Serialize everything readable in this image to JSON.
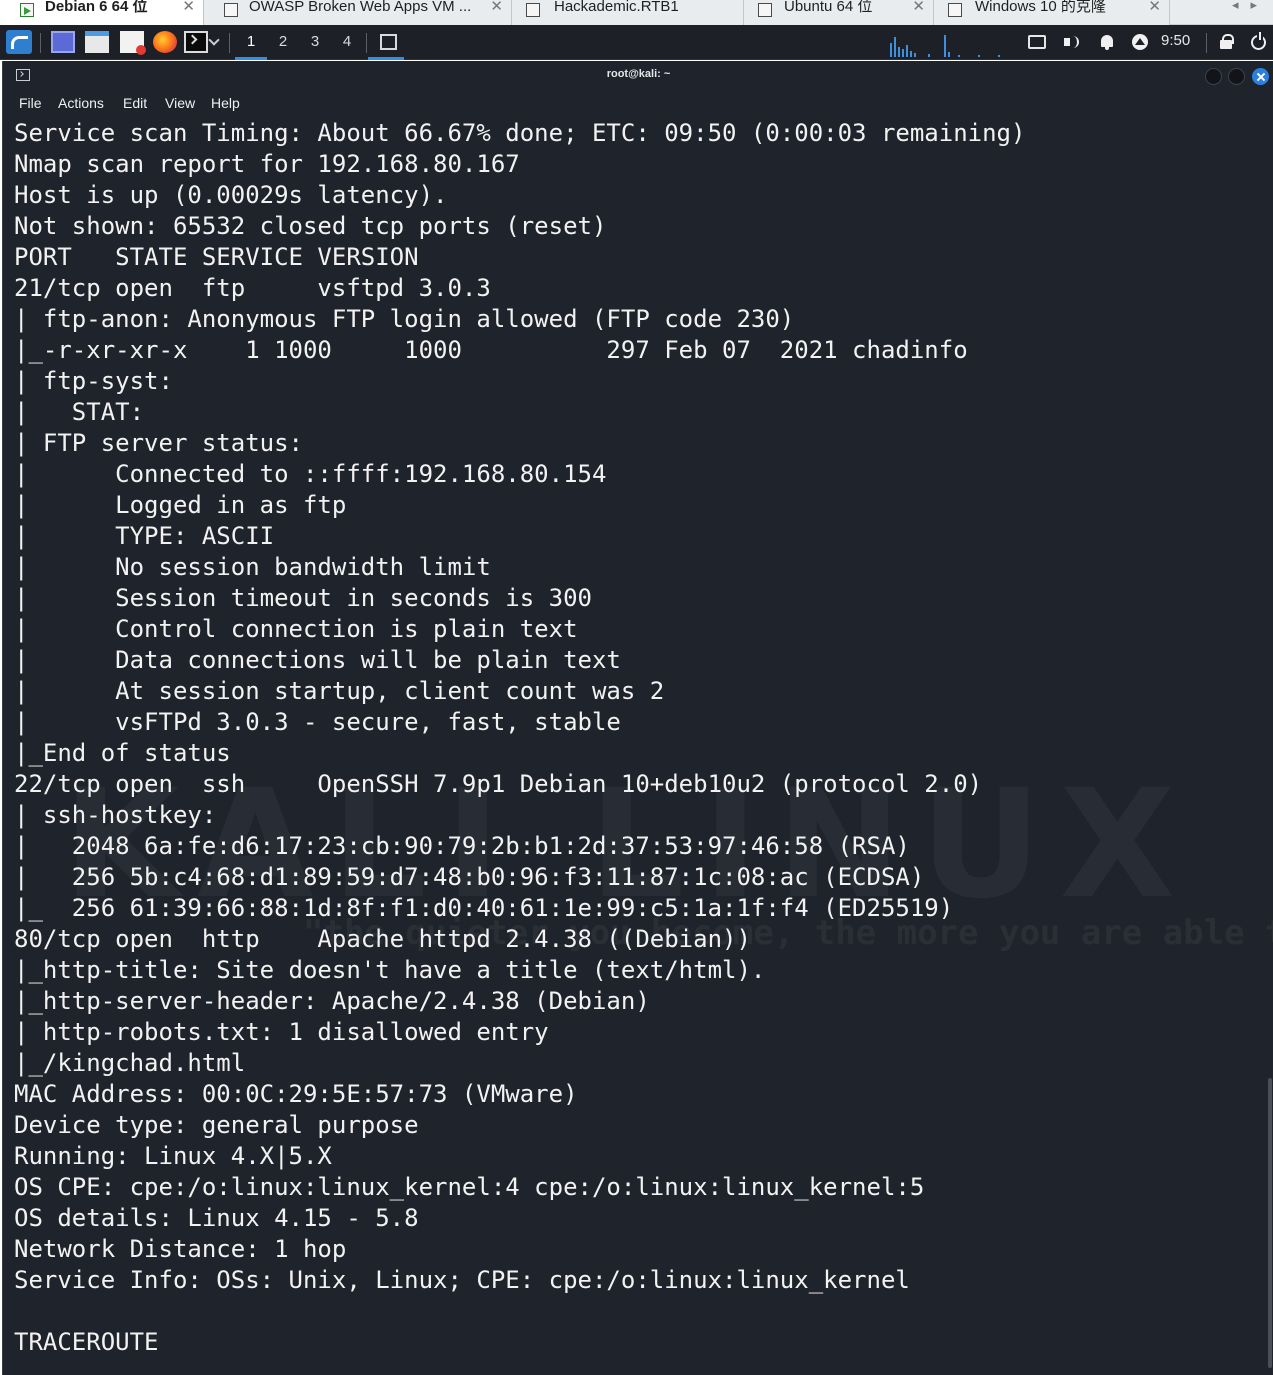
{
  "vm_tabs": [
    {
      "label": "Debian 6 64 位",
      "active": true
    },
    {
      "label": "OWASP Broken Web Apps VM ...",
      "active": false
    },
    {
      "label": "Hackademic.RTB1",
      "active": false
    },
    {
      "label": "Ubuntu 64 位",
      "active": false
    },
    {
      "label": "Windows 10 的克隆",
      "active": false
    }
  ],
  "panel": {
    "workspaces": [
      "1",
      "2",
      "3",
      "4"
    ],
    "active_workspace": "1",
    "clock": "9:50",
    "icons": [
      "kali-menu-icon",
      "show-desktop-icon",
      "file-manager-icon",
      "text-editor-icon",
      "firefox-icon",
      "terminal-icon",
      "screen-icon",
      "volume-icon",
      "notification-bell-icon",
      "network-icon",
      "lock-icon",
      "power-icon"
    ]
  },
  "window": {
    "title": "root@kali: ~",
    "menu": [
      "File",
      "Actions",
      "Edit",
      "View",
      "Help"
    ]
  },
  "terminal": {
    "lines": [
      "Service scan Timing: About 66.67% done; ETC: 09:50 (0:00:03 remaining)",
      "Nmap scan report for 192.168.80.167",
      "Host is up (0.00029s latency).",
      "Not shown: 65532 closed tcp ports (reset)",
      "PORT   STATE SERVICE VERSION",
      "21/tcp open  ftp     vsftpd 3.0.3",
      "| ftp-anon: Anonymous FTP login allowed (FTP code 230)",
      "|_-r-xr-xr-x    1 1000     1000          297 Feb 07  2021 chadinfo",
      "| ftp-syst:",
      "|   STAT:",
      "| FTP server status:",
      "|      Connected to ::ffff:192.168.80.154",
      "|      Logged in as ftp",
      "|      TYPE: ASCII",
      "|      No session bandwidth limit",
      "|      Session timeout in seconds is 300",
      "|      Control connection is plain text",
      "|      Data connections will be plain text",
      "|      At session startup, client count was 2",
      "|      vsFTPd 3.0.3 - secure, fast, stable",
      "|_End of status",
      "22/tcp open  ssh     OpenSSH 7.9p1 Debian 10+deb10u2 (protocol 2.0)",
      "| ssh-hostkey:",
      "|   2048 6a:fe:d6:17:23:cb:90:79:2b:b1:2d:37:53:97:46:58 (RSA)",
      "|   256 5b:c4:68:d1:89:59:d7:48:b0:96:f3:11:87:1c:08:ac (ECDSA)",
      "|_  256 61:39:66:88:1d:8f:f1:d0:40:61:1e:99:c5:1a:1f:f4 (ED25519)",
      "80/tcp open  http    Apache httpd 2.4.38 ((Debian))",
      "|_http-title: Site doesn't have a title (text/html).",
      "|_http-server-header: Apache/2.4.38 (Debian)",
      "| http-robots.txt: 1 disallowed entry",
      "|_/kingchad.html",
      "MAC Address: 00:0C:29:5E:57:73 (VMware)",
      "Device type: general purpose",
      "Running: Linux 4.X|5.X",
      "OS CPE: cpe:/o:linux:linux_kernel:4 cpe:/o:linux:linux_kernel:5",
      "OS details: Linux 4.15 - 5.8",
      "Network Distance: 1 hop",
      "Service Info: OSs: Unix, Linux; CPE: cpe:/o:linux:linux_kernel",
      "",
      "TRACEROUTE"
    ]
  },
  "wallpaper": {
    "watermark": "KALI LINUX",
    "quote": "\"the quieter you become, the more you are able to hear\""
  }
}
